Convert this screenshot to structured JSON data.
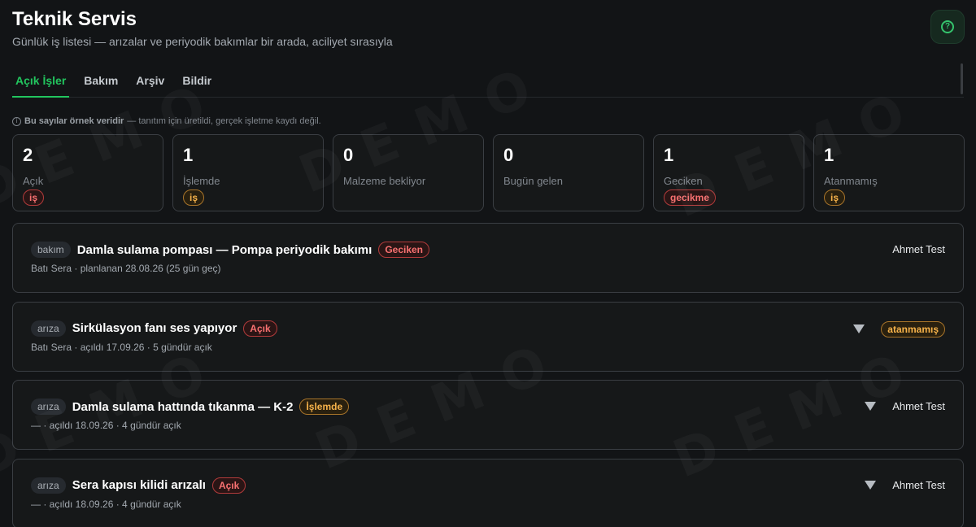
{
  "header": {
    "title": "Teknik Servis",
    "subtitle": "Günlük iş listesi — arızalar ve periyodik bakımlar bir arada, aciliyet sırasıyla",
    "help_icon": "?"
  },
  "tabs": [
    {
      "label": "Açık İşler",
      "active": true
    },
    {
      "label": "Bakım",
      "active": false
    },
    {
      "label": "Arşiv",
      "active": false
    },
    {
      "label": "Bildir",
      "active": false
    }
  ],
  "note": {
    "icon": "i",
    "bold": "Bu sayılar örnek veridir",
    "rest": "— tanıtım için üretildi, gerçek işletme kaydı değil."
  },
  "stats": [
    {
      "value": "2",
      "label": "Açık",
      "badge": "iş",
      "badge_color": "red"
    },
    {
      "value": "1",
      "label": "İşlemde",
      "badge": "iş",
      "badge_color": "amber"
    },
    {
      "value": "0",
      "label": "Malzeme bekliyor",
      "badge": "",
      "badge_color": ""
    },
    {
      "value": "0",
      "label": "Bugün gelen",
      "badge": "",
      "badge_color": ""
    },
    {
      "value": "1",
      "label": "Geciken",
      "badge": "gecikme",
      "badge_color": "red"
    },
    {
      "value": "1",
      "label": "Atanmamış",
      "badge": "iş",
      "badge_color": "amber"
    }
  ],
  "jobs": [
    {
      "type": "bakım",
      "title": "Damla sulama pompası — Pompa periyodik bakımı",
      "status": "Geciken",
      "status_color": "red",
      "meta": "Batı Sera · planlanan 28.08.26 (25 gün geç)",
      "assignee": "Ahmet Test",
      "assignee_is_badge": false,
      "has_caret": false
    },
    {
      "type": "arıza",
      "title": "Sirkülasyon fanı ses yapıyor",
      "status": "Açık",
      "status_color": "red",
      "meta": "Batı Sera · açıldı 17.09.26 · 5 gündür açık",
      "assignee": "atanmamış",
      "assignee_is_badge": true,
      "has_caret": true
    },
    {
      "type": "arıza",
      "title": "Damla sulama hattında tıkanma — K-2",
      "status": "İşlemde",
      "status_color": "amber",
      "meta": "— · açıldı 18.09.26 · 4 gündür açık",
      "assignee": "Ahmet Test",
      "assignee_is_badge": false,
      "has_caret": true
    },
    {
      "type": "arıza",
      "title": "Sera kapısı kilidi arızalı",
      "status": "Açık",
      "status_color": "red",
      "meta": "— · açıldı 18.09.26 · 4 gündür açık",
      "assignee": "Ahmet Test",
      "assignee_is_badge": false,
      "has_caret": true
    }
  ],
  "watermark": "DEMO",
  "colors": {
    "background": "#121416",
    "accent": "#22c55e",
    "red": "#f87171",
    "amber": "#f6b24a"
  }
}
